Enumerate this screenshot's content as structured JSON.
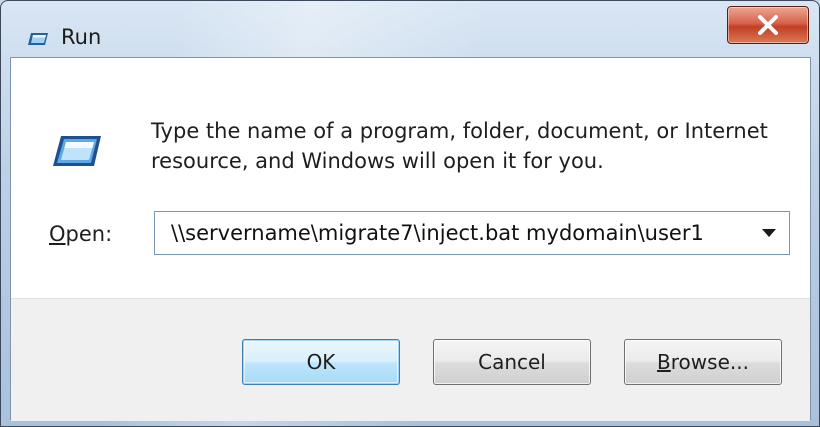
{
  "window": {
    "title": "Run",
    "close_symbol": "X",
    "accent_close": "#c9452a",
    "title_icon": "run-icon"
  },
  "content": {
    "icon": "run-icon",
    "description": "Type the name of a program, folder, document, or Internet resource, and Windows will open it for you.",
    "open_label_mnemonic": "O",
    "open_label_rest": "pen:",
    "open_value": "\\\\servername\\migrate7\\inject.bat mydomain\\user1"
  },
  "buttons": {
    "ok_label": "OK",
    "cancel_label": "Cancel",
    "browse_mnemonic": "B",
    "browse_rest": "rowse..."
  }
}
